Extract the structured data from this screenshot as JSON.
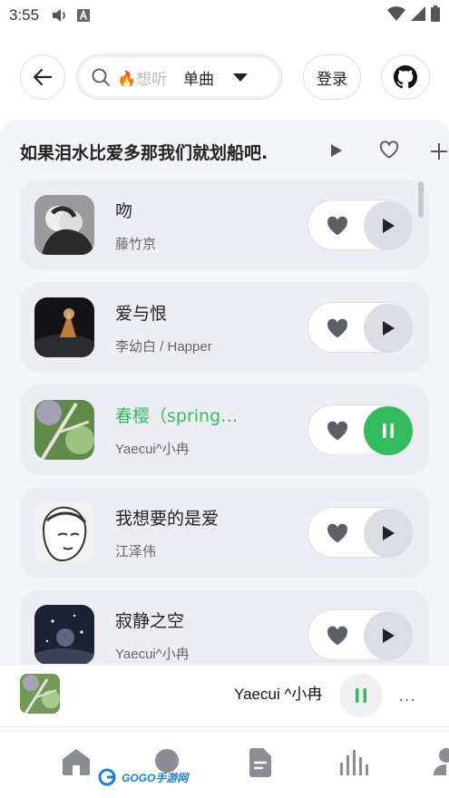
{
  "status_bar": {
    "time": "3:55",
    "icons": [
      "volume-icon",
      "font-a-icon",
      "wifi-icon",
      "cellular-icon",
      "battery-icon"
    ]
  },
  "top_bar": {
    "search": {
      "value": "🔥想听",
      "icon": "search-icon"
    },
    "search_type": {
      "selected": "单曲",
      "options": [
        "单曲"
      ]
    },
    "login_label": "登录",
    "github_icon": "github-icon"
  },
  "playlist": {
    "title": "如果泪水比爱多那我们就划船吧.",
    "actions": [
      "play-icon",
      "heart-outline-icon",
      "plus-icon"
    ],
    "songs": [
      {
        "title": "吻",
        "artist": "藤竹京",
        "playing": false,
        "cover_palette": [
          "#2a2a2a",
          "#9a9a9a"
        ]
      },
      {
        "title": "爱与恨",
        "artist": "李幼白 / Happer",
        "playing": false,
        "cover_palette": [
          "#141418",
          "#d08a3a"
        ]
      },
      {
        "title": "春樱（spring…",
        "artist": "Yaecui^小冉",
        "playing": true,
        "cover_palette": [
          "#5f8a4a",
          "#b9a6d8"
        ]
      },
      {
        "title": "我想要的是爱",
        "artist": "江泽伟",
        "playing": false,
        "cover_palette": [
          "#f2f2f2",
          "#333333"
        ]
      },
      {
        "title": "寂静之空",
        "artist": "Yaecui^小冉",
        "playing": false,
        "cover_palette": [
          "#1c2233",
          "#8fa0b8"
        ]
      }
    ]
  },
  "mini_player": {
    "track": "Yaecui ^小冉",
    "state_icon": "pause-icon",
    "more_label": "..."
  },
  "bottom_nav": {
    "items": [
      "home-icon",
      "discover-icon",
      "document-icon",
      "chart-bars-icon",
      "profile-icon"
    ]
  },
  "watermark": {
    "text": "GOGO手游网"
  },
  "colors": {
    "accent_green": "#33bb5c",
    "panel_bg": "#f4f5f8",
    "card_bg": "#eceef3",
    "icon_gray": "#5c5f66"
  }
}
